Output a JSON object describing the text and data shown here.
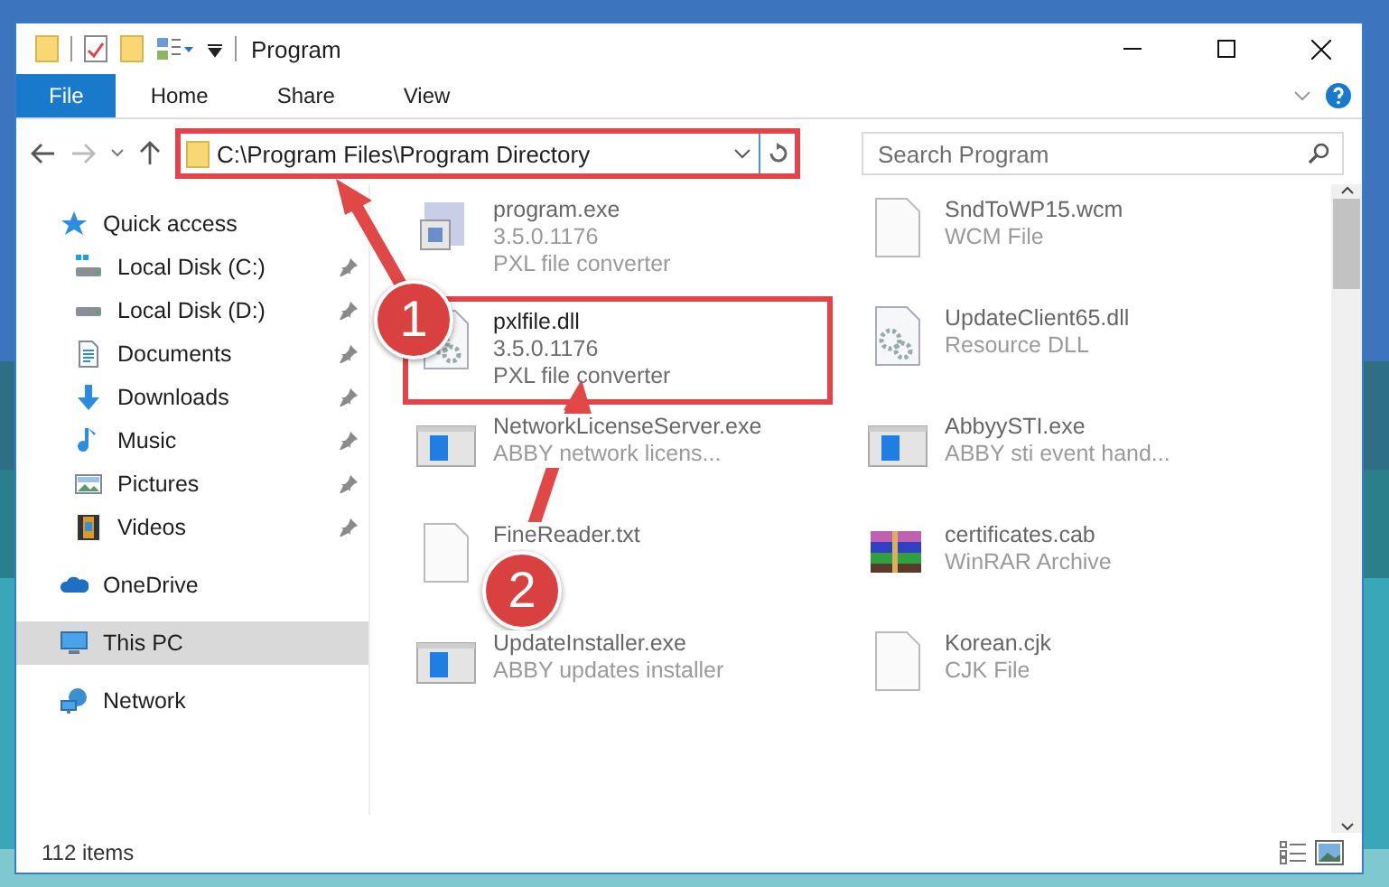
{
  "window": {
    "title": "Program"
  },
  "ribbon_tabs": [
    {
      "label": "File",
      "selected": true
    },
    {
      "label": "Home",
      "selected": false
    },
    {
      "label": "Share",
      "selected": false
    },
    {
      "label": "View",
      "selected": false
    }
  ],
  "address": {
    "path": "C:\\Program Files\\Program Directory",
    "highlighted": true
  },
  "search": {
    "placeholder": "Search Program"
  },
  "sidebar": {
    "items": [
      {
        "label": "Quick access",
        "kind": "star",
        "selected": false,
        "children": [
          {
            "label": "Local Disk (C:)",
            "kind": "drive-win",
            "pinned": true,
            "selected": false
          },
          {
            "label": "Local Disk (D:)",
            "kind": "drive",
            "pinned": true,
            "selected": false
          },
          {
            "label": "Documents",
            "kind": "documents",
            "pinned": true,
            "selected": false
          },
          {
            "label": "Downloads",
            "kind": "downloads",
            "pinned": true,
            "selected": false
          },
          {
            "label": "Music",
            "kind": "music",
            "pinned": true,
            "selected": false
          },
          {
            "label": "Pictures",
            "kind": "pictures",
            "pinned": true,
            "selected": false
          },
          {
            "label": "Videos",
            "kind": "videos",
            "pinned": true,
            "selected": false
          }
        ]
      },
      {
        "label": "OneDrive",
        "kind": "cloud",
        "selected": false
      },
      {
        "label": "This PC",
        "kind": "pc",
        "selected": true
      },
      {
        "label": "Network",
        "kind": "network",
        "selected": false
      }
    ]
  },
  "files": [
    {
      "name": "program.exe",
      "lines": [
        "3.5.0.1176",
        "PXL file converter"
      ],
      "kind": "installer",
      "blurred": true,
      "highlighted": false
    },
    {
      "name": "SndToWP15.wcm",
      "lines": [
        "WCM File"
      ],
      "kind": "blank",
      "blurred": true,
      "highlighted": false
    },
    {
      "name": "pxlfile.dll",
      "lines": [
        "3.5.0.1176",
        "PXL file converter"
      ],
      "kind": "dll",
      "blurred": false,
      "highlighted": true
    },
    {
      "name": "UpdateClient65.dll",
      "lines": [
        "Resource DLL"
      ],
      "kind": "dll",
      "blurred": true,
      "highlighted": false
    },
    {
      "name": "NetworkLicenseServer.exe",
      "lines": [
        "ABBY network licens..."
      ],
      "kind": "app",
      "blurred": true,
      "highlighted": false
    },
    {
      "name": "AbbyySTI.exe",
      "lines": [
        "ABBY sti event hand..."
      ],
      "kind": "app",
      "blurred": true,
      "highlighted": false
    },
    {
      "name": "FineReader.txt",
      "kind": "blank",
      "blurred": true,
      "highlighted": false
    },
    {
      "name": "certificates.cab",
      "lines": [
        "WinRAR Archive"
      ],
      "kind": "archive",
      "blurred": true,
      "highlighted": false
    },
    {
      "name": "UpdateInstaller.exe",
      "lines": [
        "ABBY updates installer"
      ],
      "kind": "app",
      "blurred": true,
      "highlighted": false
    },
    {
      "name": "Korean.cjk",
      "lines": [
        "CJK File"
      ],
      "kind": "blank",
      "blurred": true,
      "highlighted": false
    }
  ],
  "status_bar": {
    "items_count": "112 items"
  },
  "annotations": [
    {
      "label": "1"
    },
    {
      "label": "2"
    }
  ]
}
